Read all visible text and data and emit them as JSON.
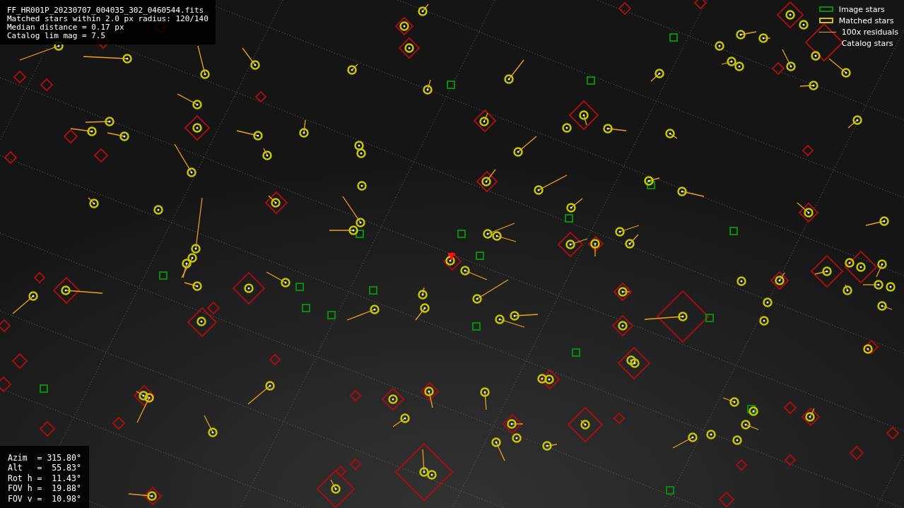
{
  "info": {
    "lines": [
      "FF_HR001P_20230707_004035_302_0460544.fits",
      "Matched stars within 2.0 px radius: 120/140",
      "Median distance = 0.17 px",
      "Catalog lim mag = 7.5"
    ]
  },
  "legend": [
    {
      "kind": "image",
      "label": "Image stars"
    },
    {
      "kind": "matched",
      "label": "Matched stars"
    },
    {
      "kind": "residual",
      "label": "100x residuals"
    },
    {
      "kind": "catalog",
      "label": "Catalog stars"
    }
  ],
  "pointing": {
    "lines": [
      "Azim  = 315.80°",
      "Alt   =  55.83°",
      "Rot h =  11.43°",
      "FOV h =  19.88°",
      "FOV v =  10.98°"
    ]
  }
}
